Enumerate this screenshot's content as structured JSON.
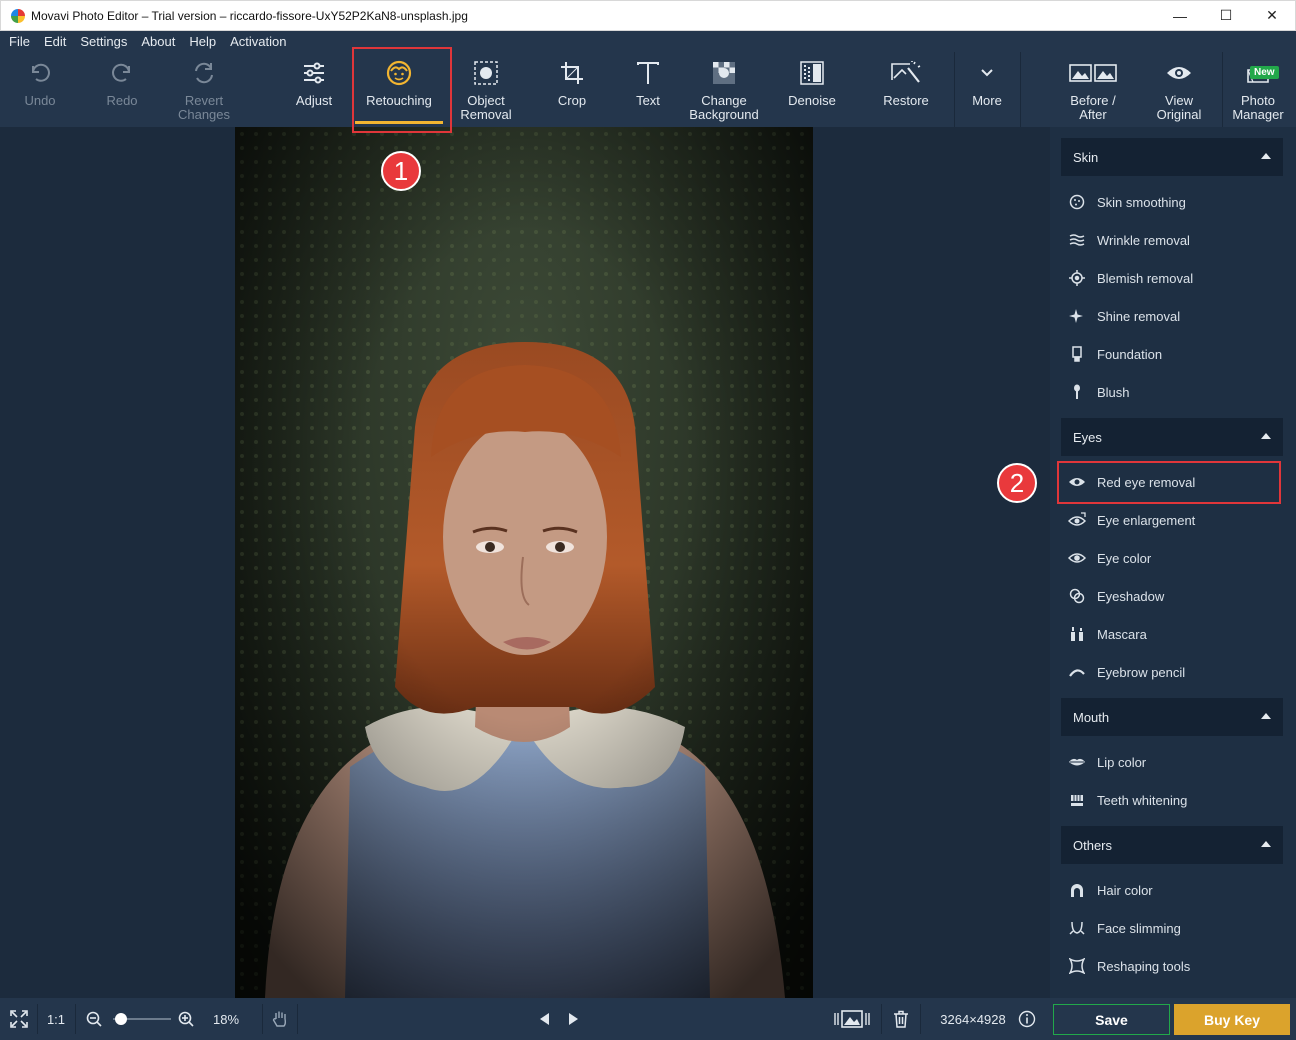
{
  "window": {
    "title": "Movavi Photo Editor – Trial version – riccardo-fissore-UxY52P2KaN8-unsplash.jpg"
  },
  "menu": [
    "File",
    "Edit",
    "Settings",
    "About",
    "Help",
    "Activation"
  ],
  "toolbar": {
    "undo": "Undo",
    "redo": "Redo",
    "revert": "Revert\nChanges",
    "adjust": "Adjust",
    "retouching": "Retouching",
    "object_removal": "Object\nRemoval",
    "crop": "Crop",
    "text": "Text",
    "change_background": "Change\nBackground",
    "denoise": "Denoise",
    "restore": "Restore",
    "more": "More",
    "before_after": "Before /\nAfter",
    "view_original": "View\nOriginal",
    "photo_manager": "Photo\nManager",
    "new_badge": "New"
  },
  "annotations": {
    "one": "1",
    "two": "2"
  },
  "panel": {
    "skin": {
      "title": "Skin",
      "items": [
        "Skin smoothing",
        "Wrinkle removal",
        "Blemish removal",
        "Shine removal",
        "Foundation",
        "Blush"
      ]
    },
    "eyes": {
      "title": "Eyes",
      "items": [
        "Red eye removal",
        "Eye enlargement",
        "Eye color",
        "Eyeshadow",
        "Mascara",
        "Eyebrow pencil"
      ]
    },
    "mouth": {
      "title": "Mouth",
      "items": [
        "Lip color",
        "Teeth whitening"
      ]
    },
    "others": {
      "title": "Others",
      "items": [
        "Hair color",
        "Face slimming",
        "Reshaping tools"
      ]
    }
  },
  "statusbar": {
    "one_to_one": "1:1",
    "zoom_percent": "18%",
    "zoom_level": 0.1,
    "dimensions": "3264×4928",
    "save": "Save",
    "buy_key": "Buy Key"
  },
  "colors": {
    "accent": "#f2b531",
    "annotation": "#e0363a",
    "save_border": "#22a84a",
    "buy_key": "#dba32c"
  }
}
